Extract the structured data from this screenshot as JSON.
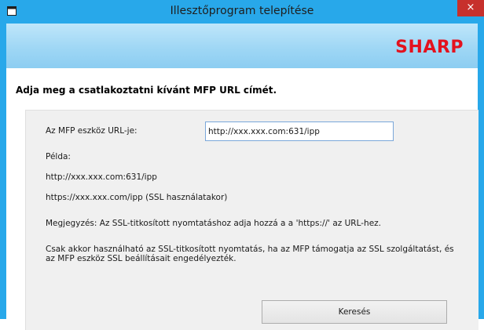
{
  "window": {
    "title": "Illesztőprogram telepítése",
    "close_glyph": "×",
    "accent_color": "#28a8ea",
    "close_color": "#c7302c"
  },
  "banner": {
    "logo_text": "SHARP",
    "logo_color": "#e3121e"
  },
  "page": {
    "heading": "Adja meg a csatlakoztatni kívánt MFP URL címét."
  },
  "form": {
    "url_label": "Az MFP eszköz URL-je:",
    "url_value": "http://xxx.xxx.com:631/ipp",
    "example_label": "Példa:",
    "example_1": "http://xxx.xxx.com:631/ipp",
    "example_2": "https://xxx.xxx.com/ipp (SSL használatakor)",
    "note_1": "Megjegyzés: Az SSL-titkosított nyomtatáshoz adja hozzá a a 'https://' az URL-hez.",
    "note_2": "Csak akkor használható az SSL-titkosított nyomtatás, ha az MFP támogatja az SSL szolgáltatást, és az MFP eszköz SSL beállításait engedélyezték.",
    "search_button": "Keresés"
  }
}
